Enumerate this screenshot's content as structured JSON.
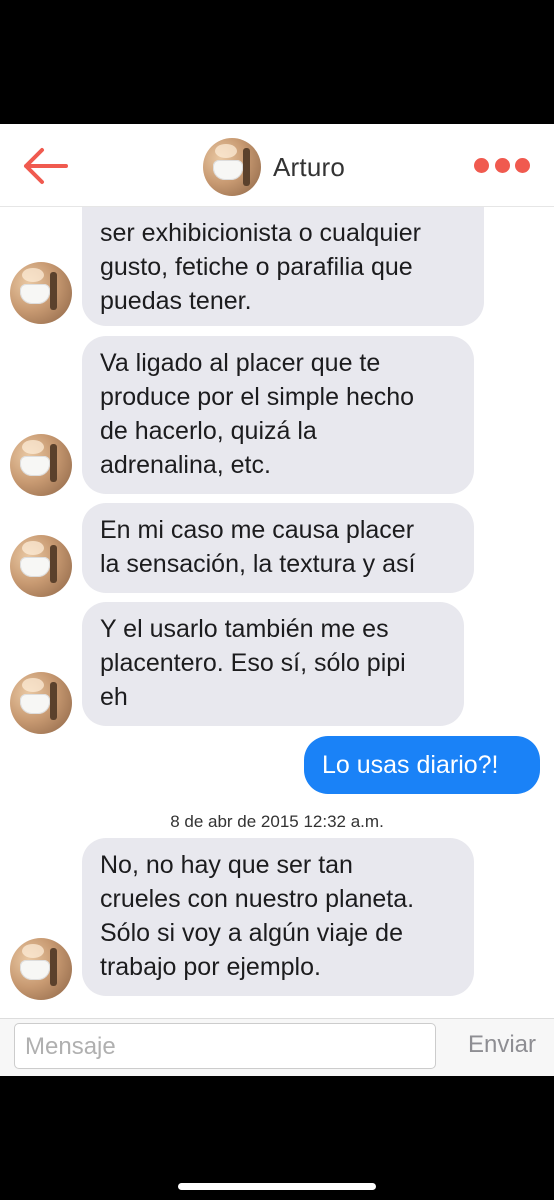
{
  "header": {
    "contact_name": "Arturo",
    "back_icon": "back-arrow-icon",
    "more_icon": "more-dots-icon",
    "accent_color": "#f05a4f"
  },
  "messages": [
    {
      "id": "m1",
      "direction": "incoming",
      "text": "ser exhibicionista o cualquier\ngusto, fetiche o parafilia que\npuedas tener."
    },
    {
      "id": "m2",
      "direction": "incoming",
      "text": "Va ligado al placer que te\nproduce por el simple hecho\nde hacerlo, quizá la\nadrenalina, etc."
    },
    {
      "id": "m3",
      "direction": "incoming",
      "text": "En mi caso me causa placer\nla sensación, la textura y así"
    },
    {
      "id": "m4",
      "direction": "incoming",
      "text": "Y el usarlo también me es\nplacentero. Eso sí, sólo pipi\neh"
    },
    {
      "id": "m5",
      "direction": "outgoing",
      "text": "Lo usas diario?!"
    },
    {
      "id": "m6",
      "direction": "incoming",
      "text": "No, no hay que ser tan\ncrueles con nuestro planeta.\nSólo si voy a algún viaje de\ntrabajo por ejemplo."
    }
  ],
  "timestamp": "8 de abr de 2015 12:32 a.m.",
  "composer": {
    "placeholder": "Mensaje",
    "send_label": "Enviar"
  },
  "colors": {
    "incoming_bubble": "#e8e8ee",
    "outgoing_bubble": "#1a82f7"
  }
}
